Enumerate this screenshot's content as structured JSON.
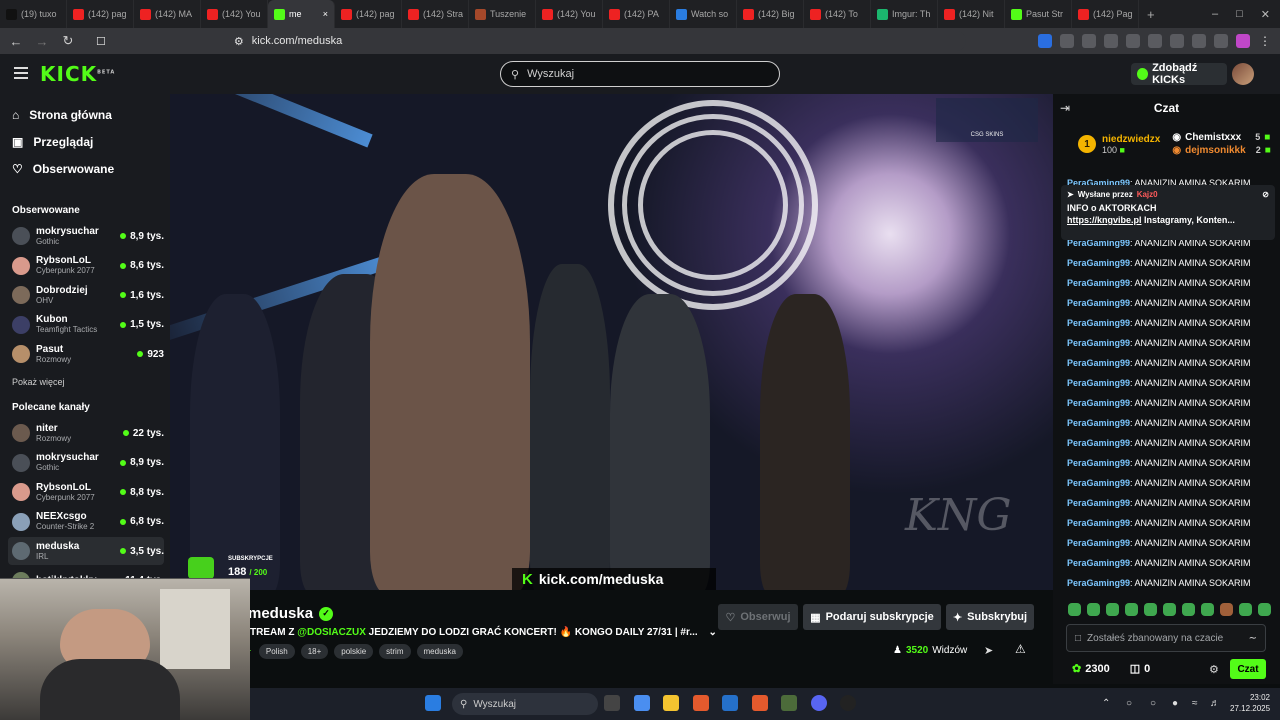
{
  "browser": {
    "tabs": [
      {
        "label": "(19) tuxo",
        "color": "#111"
      },
      {
        "label": "(142) pag",
        "color": "#e22"
      },
      {
        "label": "(142) MA",
        "color": "#e22"
      },
      {
        "label": "(142) You",
        "color": "#e22"
      },
      {
        "label": "me",
        "color": "#53fc18",
        "active": true
      },
      {
        "label": "(142) pag",
        "color": "#e22"
      },
      {
        "label": "(142) Stra",
        "color": "#e22"
      },
      {
        "label": "Tuszenie",
        "color": "#a5482a"
      },
      {
        "label": "(142) You",
        "color": "#e22"
      },
      {
        "label": "(142) PA",
        "color": "#e22"
      },
      {
        "label": "Watch so",
        "color": "#2a7de1"
      },
      {
        "label": "(142) Big",
        "color": "#e22"
      },
      {
        "label": "(142) To",
        "color": "#e22"
      },
      {
        "label": "Imgur: Th",
        "color": "#1bb76e"
      },
      {
        "label": "(142) Nit",
        "color": "#e22"
      },
      {
        "label": "Pasut Str",
        "color": "#53fc18"
      },
      {
        "label": "(142) Pag",
        "color": "#e22"
      }
    ],
    "new_tab": "+",
    "url": "kick.com/meduska"
  },
  "header": {
    "logo": "KICK",
    "logo_badge": "BETA",
    "search_placeholder": "Wyszukaj",
    "kicks_button": "Zdobądź KICKs"
  },
  "sidebar": {
    "nav": [
      {
        "label": "Strona główna",
        "icon": "home-icon"
      },
      {
        "label": "Przeglądaj",
        "icon": "browse-icon"
      },
      {
        "label": "Obserwowane",
        "icon": "heart-icon"
      }
    ],
    "followed_heading": "Obserwowane",
    "followed": [
      {
        "name": "mokrysuchar",
        "game": "Gothic",
        "viewers": "8,9 tys.",
        "color": "#4a4f57"
      },
      {
        "name": "RybsonLoL",
        "game": "Cyberpunk 2077",
        "viewers": "8,6 tys.",
        "color": "#d99a8c"
      },
      {
        "name": "Dobrodziej",
        "game": "OHV",
        "viewers": "1,6 tys.",
        "color": "#7c6a5a"
      },
      {
        "name": "Kubon",
        "game": "Teamfight Tactics",
        "viewers": "1,5 tys.",
        "color": "#3c3f66"
      },
      {
        "name": "Pasut",
        "game": "Rozmowy",
        "viewers": "923",
        "color": "#b68f6a"
      }
    ],
    "show_more": "Pokaż więcej",
    "recommended_heading": "Polecane kanały",
    "recommended": [
      {
        "name": "niter",
        "game": "Rozmowy",
        "viewers": "22 tys.",
        "color": "#6b5a4e"
      },
      {
        "name": "mokrysuchar",
        "game": "Gothic",
        "viewers": "8,9 tys.",
        "color": "#4a4f57"
      },
      {
        "name": "RybsonLoL",
        "game": "Cyberpunk 2077",
        "viewers": "8,8 tys.",
        "color": "#d99a8c"
      },
      {
        "name": "NEEXcsgo",
        "game": "Counter-Strike 2",
        "viewers": "6,8 tys.",
        "color": "#8aa0b8"
      },
      {
        "name": "meduska",
        "game": "IRL",
        "viewers": "3,5 tys.",
        "color": "#5e6a72",
        "selected": true
      },
      {
        "name": "hstikkytokky",
        "game": "",
        "viewers": "11,4 tys.",
        "color": "#6c7c5c"
      }
    ]
  },
  "video": {
    "sub_label": "SUBSKRYPCJE",
    "sub_count": "188",
    "sub_goal": "/ 200",
    "url_overlay": "kick.com/meduska",
    "watermark": "KNG",
    "sponsor": "CSG SKINS"
  },
  "stream": {
    "name": "meduska",
    "title_pre": "TREAM Z ",
    "title_mention": "@DOSIACZUX",
    "title_post": " JEDZIEMY DO LODZI GRAĆ KONCERT! 🔥 KONGO DAILY 27/31 | #r...",
    "tags": [
      "Polish",
      "18+",
      "polskie",
      "strim",
      "meduska"
    ],
    "lang_short": "L",
    "follow_label": "Obserwuj",
    "gift_label": "Podaruj subskrypcje",
    "subscribe_label": "Subskrybuj",
    "viewers": "3520",
    "viewers_label": "Widzów"
  },
  "chat": {
    "title": "Czat",
    "leader": {
      "rank": "1",
      "name": "niedzwiedzx",
      "amount": "100"
    },
    "leaders_right": [
      {
        "name": "Chemistxxx",
        "amount": "5"
      },
      {
        "name": "dejmsonikkk",
        "amount": "2"
      }
    ],
    "pinned": {
      "sent_by_label": "Wysłane przez",
      "sent_by": "Kajz0",
      "title": "INFO o AKTORKACH",
      "body_link": "https://kngvibe.pl",
      "body_rest": " Instagramy, Konten..."
    },
    "messages": [
      {
        "user": "PeraGaming99",
        "text": ": ANANIZIN AMINA SOKARIM"
      },
      {
        "user": "PeraGaming99",
        "text": ": ANANIZIN AMINA SOKARIM"
      },
      {
        "user": "PeraGaming99",
        "text": ": ANANIZIN AMINA SOKARIM"
      },
      {
        "user": "PeraGaming99",
        "text": ": ANANIZIN AMINA SOKARIM"
      },
      {
        "user": "PeraGaming99",
        "text": ": ANANIZIN AMINA SOKARIM"
      },
      {
        "user": "PeraGaming99",
        "text": ": ANANIZIN AMINA SOKARIM"
      },
      {
        "user": "PeraGaming99",
        "text": ": ANANIZIN AMINA SOKARIM"
      },
      {
        "user": "PeraGaming99",
        "text": ": ANANIZIN AMINA SOKARIM"
      },
      {
        "user": "PeraGaming99",
        "text": ": ANANIZIN AMINA SOKARIM"
      },
      {
        "user": "PeraGaming99",
        "text": ": ANANIZIN AMINA SOKARIM"
      },
      {
        "user": "PeraGaming99",
        "text": ": ANANIZIN AMINA SOKARIM"
      },
      {
        "user": "PeraGaming99",
        "text": ": ANANIZIN AMINA SOKARIM"
      },
      {
        "user": "PeraGaming99",
        "text": ": ANANIZIN AMINA SOKARIM"
      },
      {
        "user": "PeraGaming99",
        "text": ": ANANIZIN AMINA SOKARIM"
      },
      {
        "user": "PeraGaming99",
        "text": ": ANANIZIN AMINA SOKARIM"
      },
      {
        "user": "PeraGaming99",
        "text": ": ANANIZIN AMINA SOKARIM"
      },
      {
        "user": "PeraGaming99",
        "text": ": ANANIZIN AMINA SOKARIM"
      },
      {
        "user": "PeraGaming99",
        "text": ": ANANIZIN AMINA SOKARIM"
      },
      {
        "user": "PeraGaming99",
        "text": ": ANANIZIN AMINA SOKARIM"
      }
    ],
    "input_placeholder": "Zostałeś zbanowany na czacie",
    "points": "2300",
    "other_count": "0",
    "send_label": "Czat"
  },
  "taskbar": {
    "search_placeholder": "Wyszukaj",
    "time": "23:02",
    "date": "27.12.2025"
  },
  "colors": {
    "accent": "#53fc18",
    "bg": "#0b0e0f",
    "panel": "#191b1f"
  }
}
